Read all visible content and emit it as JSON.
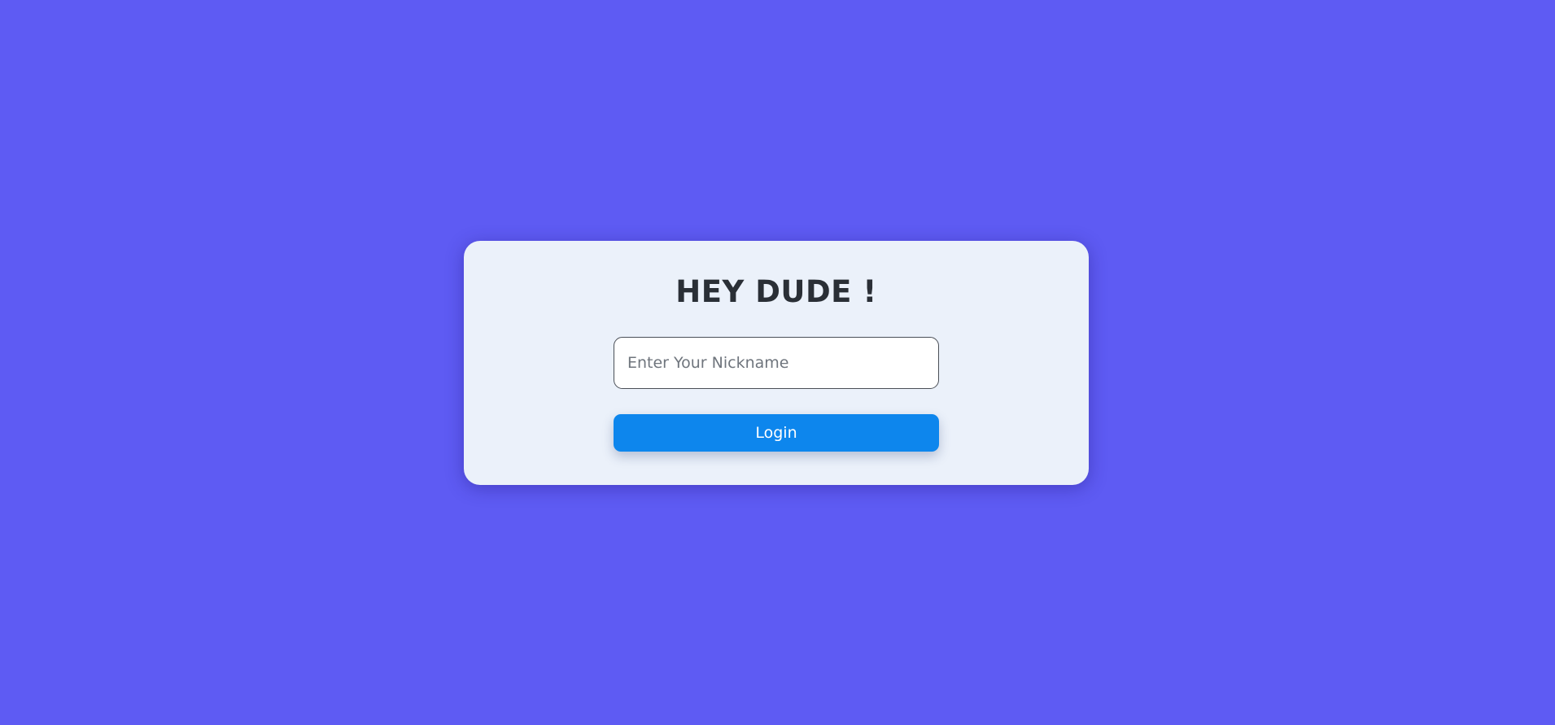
{
  "login_card": {
    "title": "HEY DUDE !",
    "nickname_placeholder": "Enter Your Nickname",
    "nickname_value": "",
    "login_label": "Login"
  },
  "colors": {
    "background": "#5e5bf3",
    "card": "#ebf1fa",
    "accent_button": "#0d86ed",
    "title_text": "#2a2f36"
  }
}
